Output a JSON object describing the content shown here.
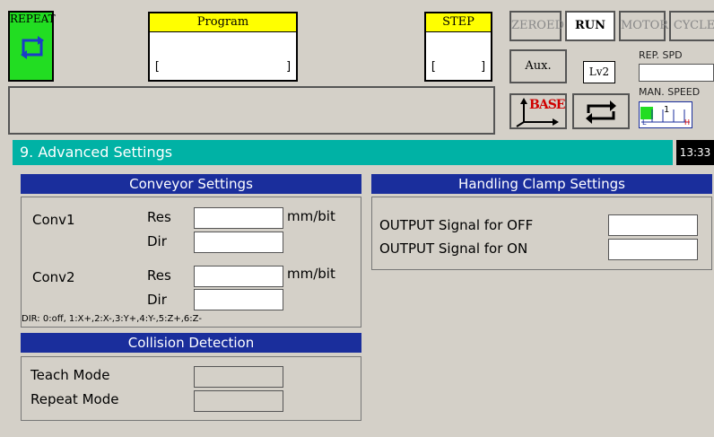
{
  "top": {
    "repeat_button": "REPEAT",
    "program": {
      "title": "Program",
      "bracket_left": "[",
      "bracket_right": "]"
    },
    "step": {
      "title": "STEP",
      "bracket_left": "[",
      "bracket_right": "]"
    },
    "modes": [
      "ZEROED",
      "RUN",
      "MOTOR",
      "CYCLE"
    ],
    "aux_label": "Aux.",
    "level": "Lv2",
    "rep_spd_label": "REP. SPD",
    "man_speed_label": "MAN. SPEED",
    "man_speed_value": "1",
    "man_speed_low": "L",
    "man_speed_high": "H",
    "base_label": "BASE"
  },
  "title_bar": {
    "title": "9. Advanced Settings",
    "time": "13:33"
  },
  "conveyor": {
    "header": "Conveyor Settings",
    "conv1_label": "Conv1",
    "conv2_label": "Conv2",
    "res_label": "Res",
    "dir_label": "Dir",
    "unit": "mm/bit",
    "conv1_res": "",
    "conv1_dir": "",
    "conv2_res": "",
    "conv2_dir": "",
    "dir_hint": "DIR: 0:off, 1:X+,2:X-,3:Y+,4:Y-,5:Z+,6:Z-"
  },
  "collision": {
    "header": "Collision Detection",
    "teach_label": "Teach Mode",
    "repeat_label": "Repeat Mode"
  },
  "clamp": {
    "header": "Handling Clamp Settings",
    "off_label": "OUTPUT Signal for OFF",
    "on_label": "OUTPUT Signal for ON",
    "off_value": "",
    "on_value": ""
  },
  "colors": {
    "accent": "#00b2a5",
    "section_header": "#1a2e9c",
    "repeat_green": "#22dd22",
    "panel_yellow": "#ffff00"
  }
}
